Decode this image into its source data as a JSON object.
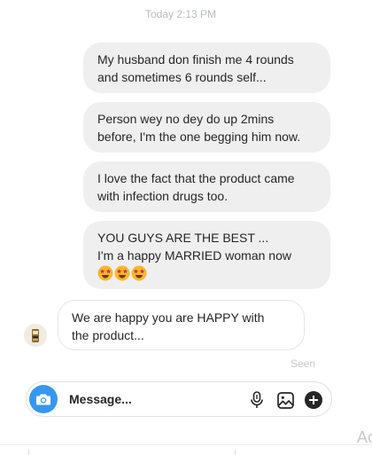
{
  "thread": {
    "timestamp": "Today 2:13 PM",
    "messages": [
      {
        "direction": "outgoing",
        "lines": [
          "My husband don finish me 4 rounds",
          "and sometimes 6 rounds self..."
        ]
      },
      {
        "direction": "outgoing",
        "lines": [
          "Person wey no dey do up 2mins",
          "before, I'm the one begging him now."
        ]
      },
      {
        "direction": "outgoing",
        "lines": [
          "I love the fact that the product came",
          "with infection drugs too."
        ]
      },
      {
        "direction": "outgoing",
        "lines": [
          "YOU GUYS ARE THE BEST ...",
          "I'm a happy MARRIED woman now"
        ],
        "emoji": "star-struck-face-icon",
        "emoji_count": 3
      },
      {
        "direction": "incoming",
        "lines": [
          "We are happy you are HAPPY with",
          "the product..."
        ]
      }
    ],
    "seen_label": "Seen"
  },
  "composer": {
    "placeholder": "Message...",
    "camera_icon": "camera-icon",
    "mic_icon": "microphone-icon",
    "image_icon": "image-icon",
    "add_icon": "plus-circle-icon",
    "accent_color": "#3797f0"
  },
  "edge": {
    "text": "Ac"
  }
}
